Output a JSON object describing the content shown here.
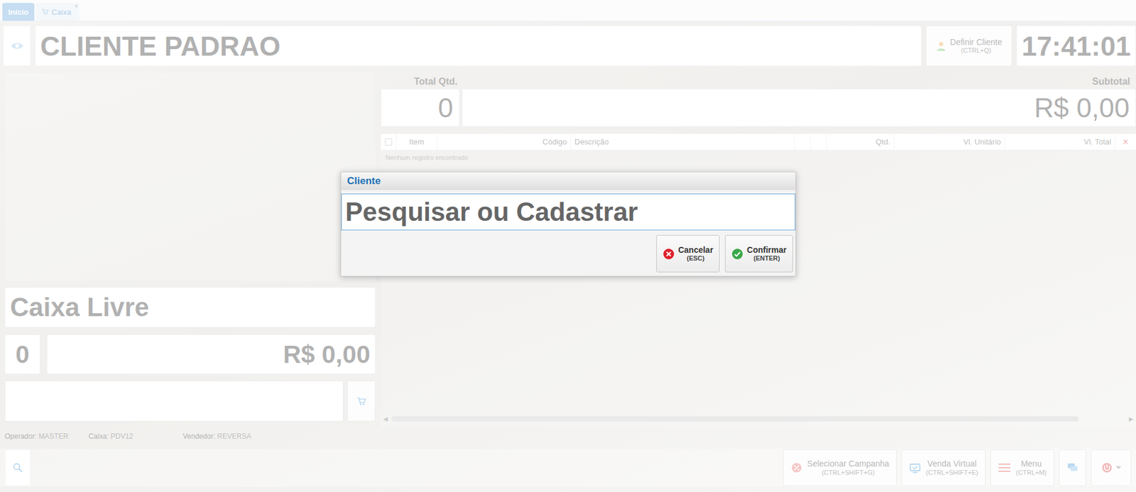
{
  "tabs": [
    {
      "label": "Início",
      "selected": true,
      "closable": false
    },
    {
      "label": "Caixa",
      "selected": false,
      "closable": true
    }
  ],
  "tab_close": "×",
  "header": {
    "client": "CLIENTE PADRAO",
    "define_client": {
      "label": "Definir Cliente",
      "shortcut": "(CTRL+Q)"
    },
    "clock": "17:41:01"
  },
  "left": {
    "status": "Caixa Livre",
    "count": "0",
    "amount": "R$ 0,00"
  },
  "summary": {
    "qty_label": "Total Qtd.",
    "qty": "0",
    "subtotal_label": "Subtotal",
    "subtotal": "R$ 0,00"
  },
  "table": {
    "columns": [
      "Item",
      "Código",
      "Descrição",
      "",
      "",
      "Qtd.",
      "Vl. Unitário",
      "Vl. Total"
    ],
    "empty": "Nenhum registro encontrado",
    "remove": "×"
  },
  "scroll": {
    "left": "◀",
    "right": "▶"
  },
  "status_bar": [
    {
      "label": "Operador:",
      "value": "MASTER"
    },
    {
      "label": "Caixa:",
      "value": "PDV12"
    },
    {
      "label": "Vendedor:",
      "value": "REVERSA"
    }
  ],
  "toolbar": {
    "buttons": [
      {
        "label": "Selecionar Campanha",
        "shortcut": "(CTRL+SHIFT+G)",
        "kind": "campaign"
      },
      {
        "label": "Venda Virtual",
        "shortcut": "(CTRL+SHIFT+E)",
        "kind": "virtual"
      },
      {
        "label": "Menu",
        "shortcut": "(CTRL+M)",
        "kind": "menu"
      }
    ]
  },
  "dialog": {
    "title": "Cliente",
    "placeholder": "Pesquisar ou Cadastrar",
    "buttons": [
      {
        "label": "Cancelar",
        "shortcut": "(ESC)",
        "kind": "cancel"
      },
      {
        "label": "Confirmar",
        "shortcut": "(ENTER)",
        "kind": "confirm"
      }
    ]
  }
}
